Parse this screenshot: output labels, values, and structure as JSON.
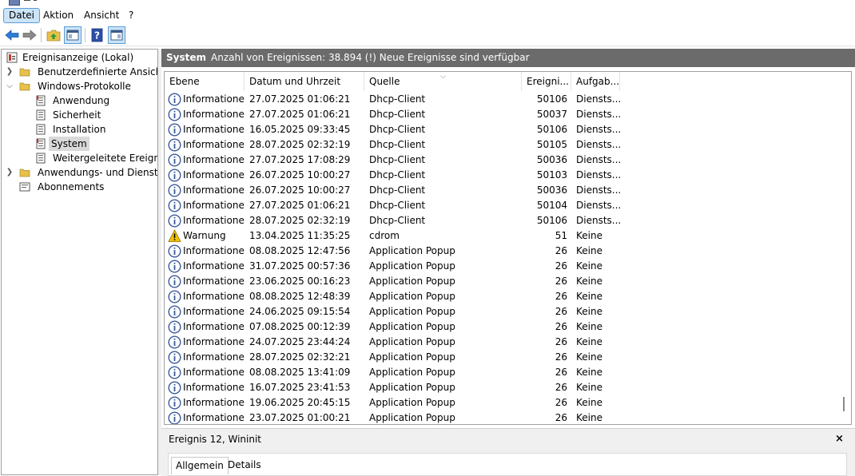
{
  "menu": {
    "items": [
      "Datei",
      "Aktion",
      "Ansicht",
      "?"
    ]
  },
  "tree": {
    "items": [
      {
        "label": "Ereignisanzeige (Lokal)"
      },
      {
        "label": "Benutzerdefinierte Ansichten"
      },
      {
        "label": "Windows-Protokolle"
      },
      {
        "label": "Anwendung"
      },
      {
        "label": "Sicherheit"
      },
      {
        "label": "Installation"
      },
      {
        "label": "System"
      },
      {
        "label": "Weitergeleitete Ereignisse"
      },
      {
        "label": "Anwendungs- und Dienstprotokolle"
      },
      {
        "label": "Abonnements"
      }
    ],
    "selected": "System"
  },
  "header": {
    "title": "System",
    "message": "Anzahl von Ereignissen: 38.894 (!) Neue Ereignisse sind verfügbar"
  },
  "columns": [
    "Ebene",
    "Datum und Uhrzeit",
    "Quelle",
    "Ereigni...",
    "Aufgab..."
  ],
  "events": [
    {
      "level": "Informationen",
      "icon": "info",
      "datetime": "27.07.2025 01:06:21",
      "source": "Dhcp-Client",
      "id": "50106",
      "task": "Diensts..."
    },
    {
      "level": "Informationen",
      "icon": "info",
      "datetime": "27.07.2025 01:06:21",
      "source": "Dhcp-Client",
      "id": "50037",
      "task": "Diensts..."
    },
    {
      "level": "Informationen",
      "icon": "info",
      "datetime": "16.05.2025 09:33:45",
      "source": "Dhcp-Client",
      "id": "50106",
      "task": "Diensts..."
    },
    {
      "level": "Informationen",
      "icon": "info",
      "datetime": "28.07.2025 02:32:19",
      "source": "Dhcp-Client",
      "id": "50105",
      "task": "Diensts..."
    },
    {
      "level": "Informationen",
      "icon": "info",
      "datetime": "27.07.2025 17:08:29",
      "source": "Dhcp-Client",
      "id": "50036",
      "task": "Diensts..."
    },
    {
      "level": "Informationen",
      "icon": "info",
      "datetime": "26.07.2025 10:00:27",
      "source": "Dhcp-Client",
      "id": "50103",
      "task": "Diensts..."
    },
    {
      "level": "Informationen",
      "icon": "info",
      "datetime": "26.07.2025 10:00:27",
      "source": "Dhcp-Client",
      "id": "50036",
      "task": "Diensts..."
    },
    {
      "level": "Informationen",
      "icon": "info",
      "datetime": "27.07.2025 01:06:21",
      "source": "Dhcp-Client",
      "id": "50104",
      "task": "Diensts..."
    },
    {
      "level": "Informationen",
      "icon": "info",
      "datetime": "28.07.2025 02:32:19",
      "source": "Dhcp-Client",
      "id": "50106",
      "task": "Diensts..."
    },
    {
      "level": "Warnung",
      "icon": "warning",
      "datetime": "13.04.2025 11:35:25",
      "source": "cdrom",
      "id": "51",
      "task": "Keine"
    },
    {
      "level": "Informationen",
      "icon": "info",
      "datetime": "08.08.2025 12:47:56",
      "source": "Application Popup",
      "id": "26",
      "task": "Keine"
    },
    {
      "level": "Informationen",
      "icon": "info",
      "datetime": "31.07.2025 00:57:36",
      "source": "Application Popup",
      "id": "26",
      "task": "Keine"
    },
    {
      "level": "Informationen",
      "icon": "info",
      "datetime": "23.06.2025 00:16:23",
      "source": "Application Popup",
      "id": "26",
      "task": "Keine"
    },
    {
      "level": "Informationen",
      "icon": "info",
      "datetime": "08.08.2025 12:48:39",
      "source": "Application Popup",
      "id": "26",
      "task": "Keine"
    },
    {
      "level": "Informationen",
      "icon": "info",
      "datetime": "24.06.2025 09:15:54",
      "source": "Application Popup",
      "id": "26",
      "task": "Keine"
    },
    {
      "level": "Informationen",
      "icon": "info",
      "datetime": "07.08.2025 00:12:39",
      "source": "Application Popup",
      "id": "26",
      "task": "Keine"
    },
    {
      "level": "Informationen",
      "icon": "info",
      "datetime": "24.07.2025 23:44:24",
      "source": "Application Popup",
      "id": "26",
      "task": "Keine"
    },
    {
      "level": "Informationen",
      "icon": "info",
      "datetime": "28.07.2025 02:32:21",
      "source": "Application Popup",
      "id": "26",
      "task": "Keine"
    },
    {
      "level": "Informationen",
      "icon": "info",
      "datetime": "08.08.2025 13:41:09",
      "source": "Application Popup",
      "id": "26",
      "task": "Keine"
    },
    {
      "level": "Informationen",
      "icon": "info",
      "datetime": "16.07.2025 23:41:53",
      "source": "Application Popup",
      "id": "26",
      "task": "Keine"
    },
    {
      "level": "Informationen",
      "icon": "info",
      "datetime": "19.06.2025 20:45:15",
      "source": "Application Popup",
      "id": "26",
      "task": "Keine"
    },
    {
      "level": "Informationen",
      "icon": "info",
      "datetime": "23.07.2025 01:00:21",
      "source": "Application Popup",
      "id": "26",
      "task": "Keine"
    }
  ],
  "detail": {
    "title": "Ereignis 12, Wininit",
    "close": "×",
    "tabs": [
      "Allgemein",
      "Details"
    ]
  },
  "colors": {
    "header_bg": "#6b6b6b",
    "selection": "#cce4f7",
    "info_icon": "#3a5a9a",
    "warning_icon": "#f2c200"
  }
}
